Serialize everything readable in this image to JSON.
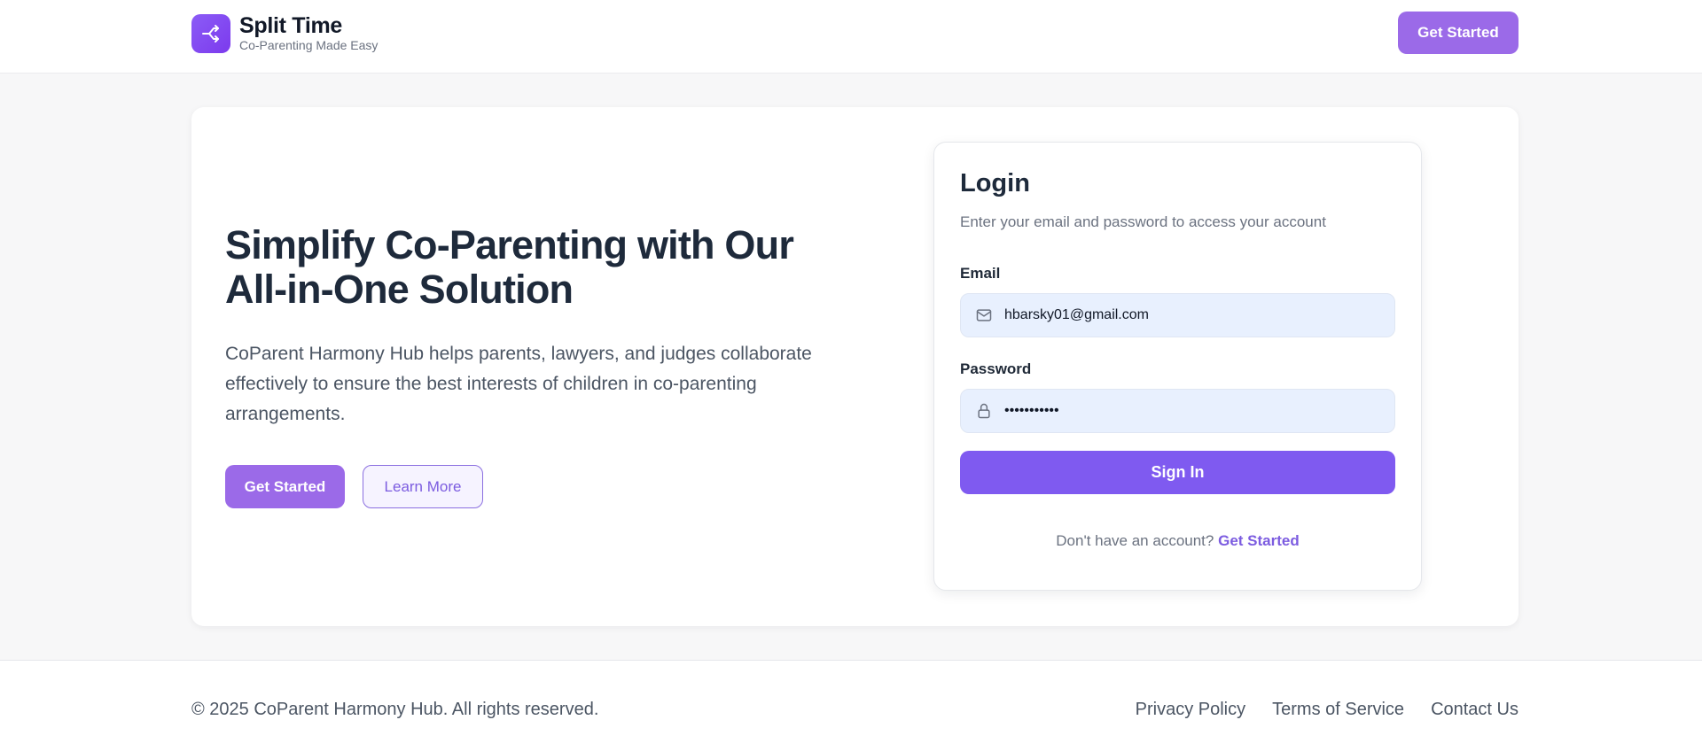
{
  "header": {
    "brand_title": "Split Time",
    "brand_tagline": "Co-Parenting Made Easy",
    "cta_label": "Get Started"
  },
  "hero": {
    "title": "Simplify Co-Parenting with Our All-in-One Solution",
    "description": "CoParent Harmony Hub helps parents, lawyers, and judges collaborate effectively to ensure the best interests of children in co-parenting arrangements.",
    "primary_button": "Get Started",
    "secondary_button": "Learn More"
  },
  "login": {
    "title": "Login",
    "subtitle": "Enter your email and password to access your account",
    "email_label": "Email",
    "email_value": "hbarsky01@gmail.com",
    "password_label": "Password",
    "password_value": "•••••••••••",
    "submit_label": "Sign In",
    "signup_prompt": "Don't have an account?",
    "signup_link": "Get Started"
  },
  "footer": {
    "copyright": "© 2025 CoParent Harmony Hub. All rights reserved.",
    "links": [
      "Privacy Policy",
      "Terms of Service",
      "Contact Us"
    ]
  },
  "colors": {
    "accent": "#7f5af0",
    "button_purple": "#9b6ae8",
    "input_bg": "#e8f0fe"
  },
  "icons": {
    "logo": "split-arrows-icon",
    "email": "mail-icon",
    "password": "lock-icon"
  }
}
